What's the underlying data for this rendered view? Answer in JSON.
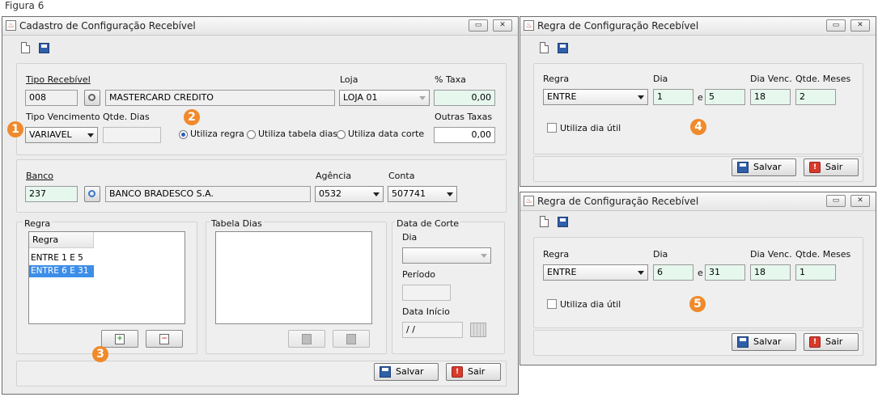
{
  "figure_label": "Figura 6",
  "main_window": {
    "title": "Cadastro de Configuração Recebível",
    "section1": {
      "tipo_recebivel_label": "Tipo Recebível",
      "tipo_recebivel_code": "008",
      "tipo_recebivel_name": "MASTERCARD CREDITO",
      "loja_label": "Loja",
      "loja_value": "LOJA 01",
      "taxa_label": "% Taxa",
      "taxa_value": "0,00",
      "tipo_vencimento_label": "Tipo Vencimento",
      "tipo_vencimento_value": "VARIAVEL",
      "qtde_dias_label": "Qtde. Dias",
      "qtde_dias_value": "",
      "radio_utiliza_regra": "Utiliza regra",
      "radio_utiliza_tabela_dias": "Utiliza tabela dias",
      "radio_utiliza_data_corte": "Utiliza data corte",
      "outras_taxas_label": "Outras Taxas",
      "outras_taxas_value": "0,00"
    },
    "section2": {
      "banco_label": "Banco",
      "banco_code": "237",
      "banco_name": "BANCO BRADESCO S.A.",
      "agencia_label": "Agência",
      "agencia_value": "0532",
      "conta_label": "Conta",
      "conta_value": "507741"
    },
    "regra_panel": {
      "title": "Regra",
      "column_header": "Regra",
      "rows": [
        "ENTRE 1 E 5",
        "ENTRE 6 E 31"
      ],
      "selected_index": 1
    },
    "tabela_dias_panel": {
      "title": "Tabela Dias"
    },
    "data_corte_panel": {
      "title": "Data de Corte",
      "dia_label": "Dia",
      "periodo_label": "Período",
      "data_inicio_label": "Data Início",
      "data_inicio_value": " / /"
    },
    "save_label": "Salvar",
    "exit_label": "Sair"
  },
  "rule_window_1": {
    "title": "Regra de Configuração Recebível",
    "regra_label": "Regra",
    "regra_value": "ENTRE",
    "dia_label": "Dia",
    "dia_from": "1",
    "connector": "e",
    "dia_to": "5",
    "dia_venc_label": "Dia Venc.",
    "dia_venc_value": "18",
    "qtde_meses_label": "Qtde. Meses",
    "qtde_meses_value": "2",
    "utiliza_dia_util_label": "Utiliza dia útil",
    "save_label": "Salvar",
    "exit_label": "Sair"
  },
  "rule_window_2": {
    "title": "Regra de Configuração Recebível",
    "regra_label": "Regra",
    "regra_value": "ENTRE",
    "dia_label": "Dia",
    "dia_from": "6",
    "connector": "e",
    "dia_to": "31",
    "dia_venc_label": "Dia Venc.",
    "dia_venc_value": "18",
    "qtde_meses_label": "Qtde. Meses",
    "qtde_meses_value": "1",
    "utiliza_dia_util_label": "Utiliza dia útil",
    "save_label": "Salvar",
    "exit_label": "Sair"
  },
  "callouts": [
    "1",
    "2",
    "3",
    "4",
    "5"
  ],
  "colors": {
    "callout": "#f08a2b",
    "selection": "#3d8ee8",
    "green_field": "#e6f7ee"
  }
}
